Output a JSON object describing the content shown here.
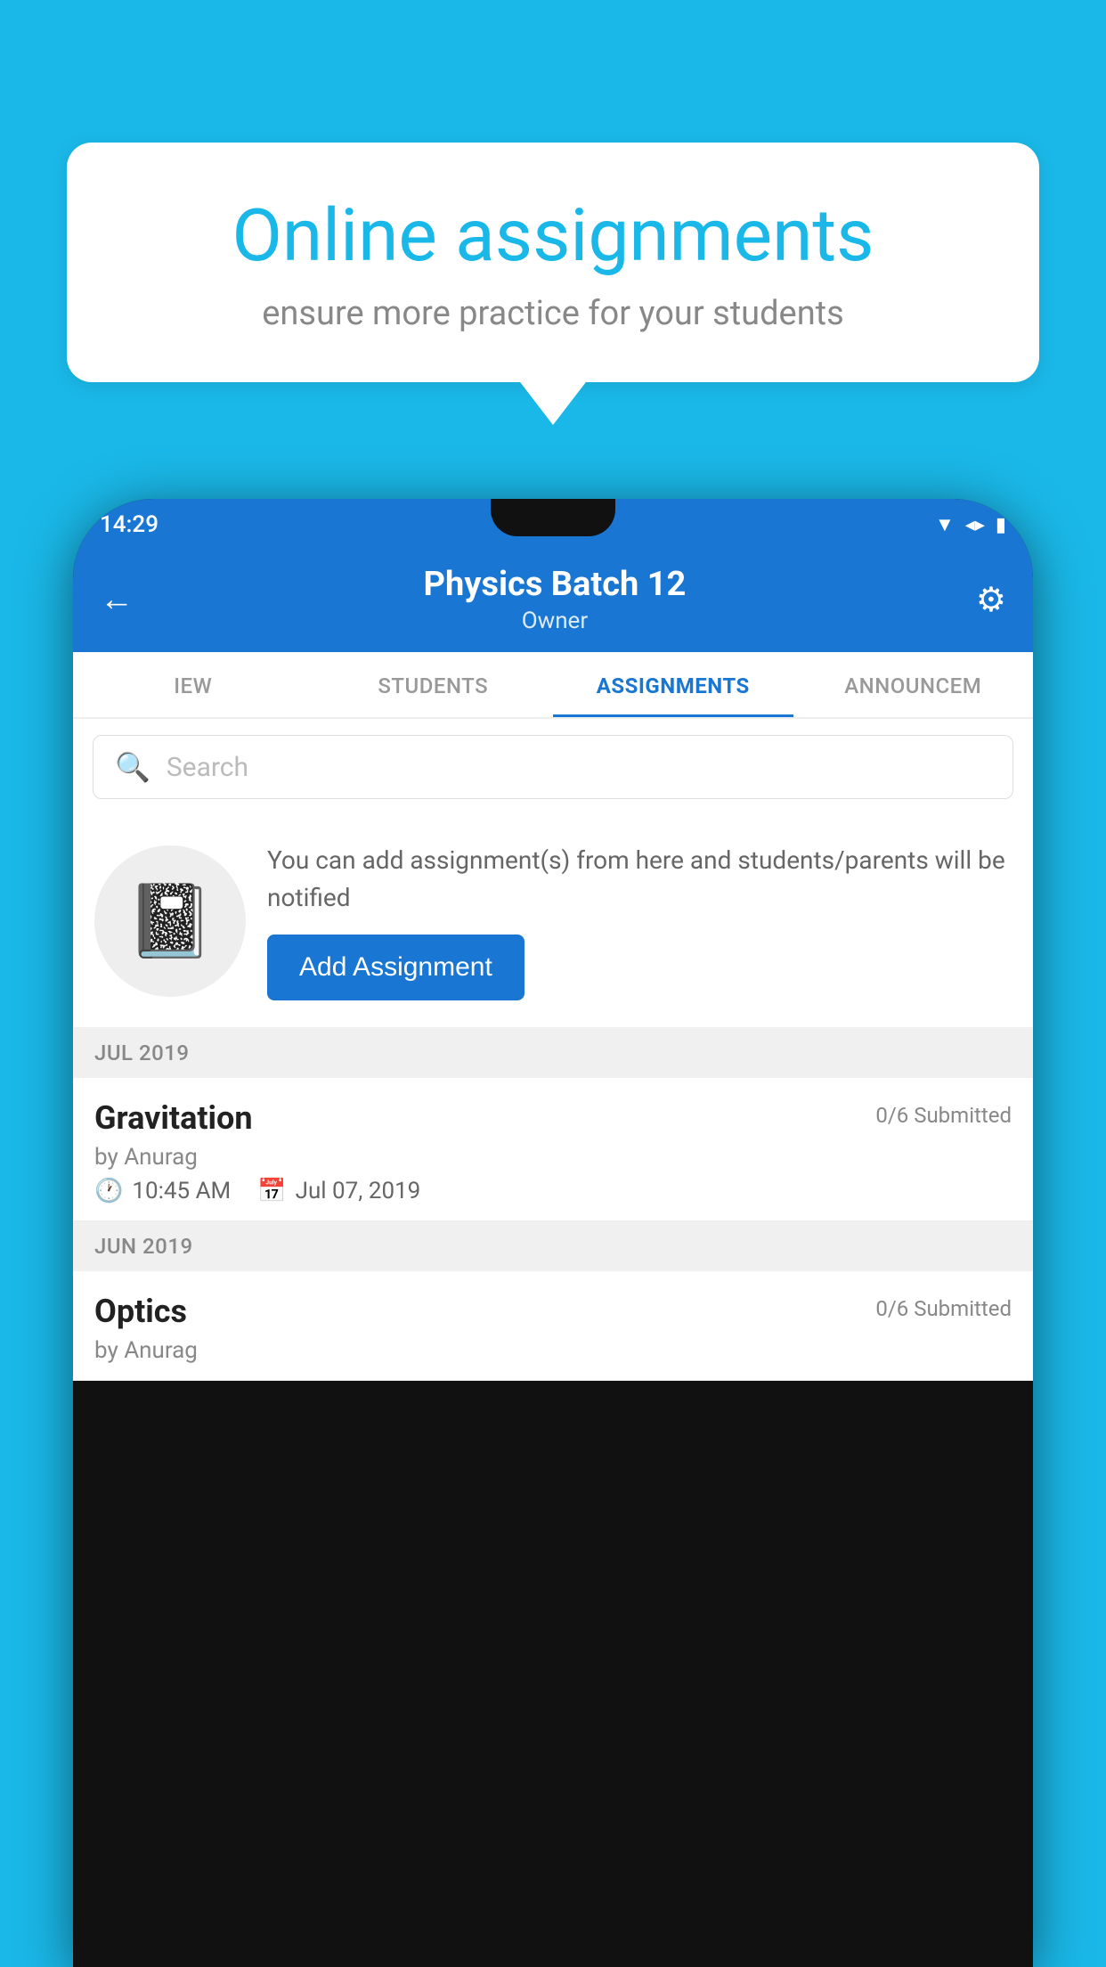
{
  "background_color": "#1ab8e8",
  "speech_bubble": {
    "title": "Online assignments",
    "subtitle": "ensure more practice for your students"
  },
  "phone": {
    "status_bar": {
      "time": "14:29",
      "icons": [
        "wifi",
        "signal",
        "battery"
      ]
    },
    "header": {
      "title": "Physics Batch 12",
      "subtitle": "Owner",
      "back_label": "←",
      "gear_label": "⚙"
    },
    "tabs": [
      {
        "label": "IEW",
        "active": false
      },
      {
        "label": "STUDENTS",
        "active": false
      },
      {
        "label": "ASSIGNMENTS",
        "active": true
      },
      {
        "label": "ANNOUNCEM...",
        "active": false
      }
    ],
    "search": {
      "placeholder": "Search"
    },
    "promo": {
      "text": "You can add assignment(s) from here and students/parents will be notified",
      "button_label": "Add Assignment"
    },
    "sections": [
      {
        "month": "JUL 2019",
        "assignments": [
          {
            "title": "Gravitation",
            "submitted": "0/6 Submitted",
            "by": "by Anurag",
            "time": "10:45 AM",
            "date": "Jul 07, 2019"
          }
        ]
      },
      {
        "month": "JUN 2019",
        "assignments": [
          {
            "title": "Optics",
            "submitted": "0/6 Submitted",
            "by": "by Anurag",
            "time": "",
            "date": ""
          }
        ]
      }
    ]
  }
}
